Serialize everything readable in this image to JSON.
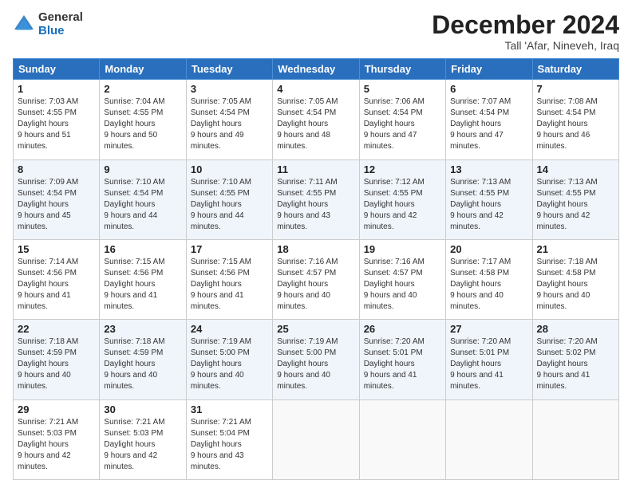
{
  "header": {
    "logo_general": "General",
    "logo_blue": "Blue",
    "month_title": "December 2024",
    "location": "Tall 'Afar, Nineveh, Iraq"
  },
  "weekdays": [
    "Sunday",
    "Monday",
    "Tuesday",
    "Wednesday",
    "Thursday",
    "Friday",
    "Saturday"
  ],
  "weeks": [
    [
      {
        "day": "1",
        "sunrise": "7:03 AM",
        "sunset": "4:55 PM",
        "daylight": "9 hours and 51 minutes."
      },
      {
        "day": "2",
        "sunrise": "7:04 AM",
        "sunset": "4:55 PM",
        "daylight": "9 hours and 50 minutes."
      },
      {
        "day": "3",
        "sunrise": "7:05 AM",
        "sunset": "4:54 PM",
        "daylight": "9 hours and 49 minutes."
      },
      {
        "day": "4",
        "sunrise": "7:05 AM",
        "sunset": "4:54 PM",
        "daylight": "9 hours and 48 minutes."
      },
      {
        "day": "5",
        "sunrise": "7:06 AM",
        "sunset": "4:54 PM",
        "daylight": "9 hours and 47 minutes."
      },
      {
        "day": "6",
        "sunrise": "7:07 AM",
        "sunset": "4:54 PM",
        "daylight": "9 hours and 47 minutes."
      },
      {
        "day": "7",
        "sunrise": "7:08 AM",
        "sunset": "4:54 PM",
        "daylight": "9 hours and 46 minutes."
      }
    ],
    [
      {
        "day": "8",
        "sunrise": "7:09 AM",
        "sunset": "4:54 PM",
        "daylight": "9 hours and 45 minutes."
      },
      {
        "day": "9",
        "sunrise": "7:10 AM",
        "sunset": "4:54 PM",
        "daylight": "9 hours and 44 minutes."
      },
      {
        "day": "10",
        "sunrise": "7:10 AM",
        "sunset": "4:55 PM",
        "daylight": "9 hours and 44 minutes."
      },
      {
        "day": "11",
        "sunrise": "7:11 AM",
        "sunset": "4:55 PM",
        "daylight": "9 hours and 43 minutes."
      },
      {
        "day": "12",
        "sunrise": "7:12 AM",
        "sunset": "4:55 PM",
        "daylight": "9 hours and 42 minutes."
      },
      {
        "day": "13",
        "sunrise": "7:13 AM",
        "sunset": "4:55 PM",
        "daylight": "9 hours and 42 minutes."
      },
      {
        "day": "14",
        "sunrise": "7:13 AM",
        "sunset": "4:55 PM",
        "daylight": "9 hours and 42 minutes."
      }
    ],
    [
      {
        "day": "15",
        "sunrise": "7:14 AM",
        "sunset": "4:56 PM",
        "daylight": "9 hours and 41 minutes."
      },
      {
        "day": "16",
        "sunrise": "7:15 AM",
        "sunset": "4:56 PM",
        "daylight": "9 hours and 41 minutes."
      },
      {
        "day": "17",
        "sunrise": "7:15 AM",
        "sunset": "4:56 PM",
        "daylight": "9 hours and 41 minutes."
      },
      {
        "day": "18",
        "sunrise": "7:16 AM",
        "sunset": "4:57 PM",
        "daylight": "9 hours and 40 minutes."
      },
      {
        "day": "19",
        "sunrise": "7:16 AM",
        "sunset": "4:57 PM",
        "daylight": "9 hours and 40 minutes."
      },
      {
        "day": "20",
        "sunrise": "7:17 AM",
        "sunset": "4:58 PM",
        "daylight": "9 hours and 40 minutes."
      },
      {
        "day": "21",
        "sunrise": "7:18 AM",
        "sunset": "4:58 PM",
        "daylight": "9 hours and 40 minutes."
      }
    ],
    [
      {
        "day": "22",
        "sunrise": "7:18 AM",
        "sunset": "4:59 PM",
        "daylight": "9 hours and 40 minutes."
      },
      {
        "day": "23",
        "sunrise": "7:18 AM",
        "sunset": "4:59 PM",
        "daylight": "9 hours and 40 minutes."
      },
      {
        "day": "24",
        "sunrise": "7:19 AM",
        "sunset": "5:00 PM",
        "daylight": "9 hours and 40 minutes."
      },
      {
        "day": "25",
        "sunrise": "7:19 AM",
        "sunset": "5:00 PM",
        "daylight": "9 hours and 40 minutes."
      },
      {
        "day": "26",
        "sunrise": "7:20 AM",
        "sunset": "5:01 PM",
        "daylight": "9 hours and 41 minutes."
      },
      {
        "day": "27",
        "sunrise": "7:20 AM",
        "sunset": "5:01 PM",
        "daylight": "9 hours and 41 minutes."
      },
      {
        "day": "28",
        "sunrise": "7:20 AM",
        "sunset": "5:02 PM",
        "daylight": "9 hours and 41 minutes."
      }
    ],
    [
      {
        "day": "29",
        "sunrise": "7:21 AM",
        "sunset": "5:03 PM",
        "daylight": "9 hours and 42 minutes."
      },
      {
        "day": "30",
        "sunrise": "7:21 AM",
        "sunset": "5:03 PM",
        "daylight": "9 hours and 42 minutes."
      },
      {
        "day": "31",
        "sunrise": "7:21 AM",
        "sunset": "5:04 PM",
        "daylight": "9 hours and 43 minutes."
      },
      null,
      null,
      null,
      null
    ]
  ],
  "labels": {
    "sunrise": "Sunrise:",
    "sunset": "Sunset:",
    "daylight": "Daylight hours"
  }
}
